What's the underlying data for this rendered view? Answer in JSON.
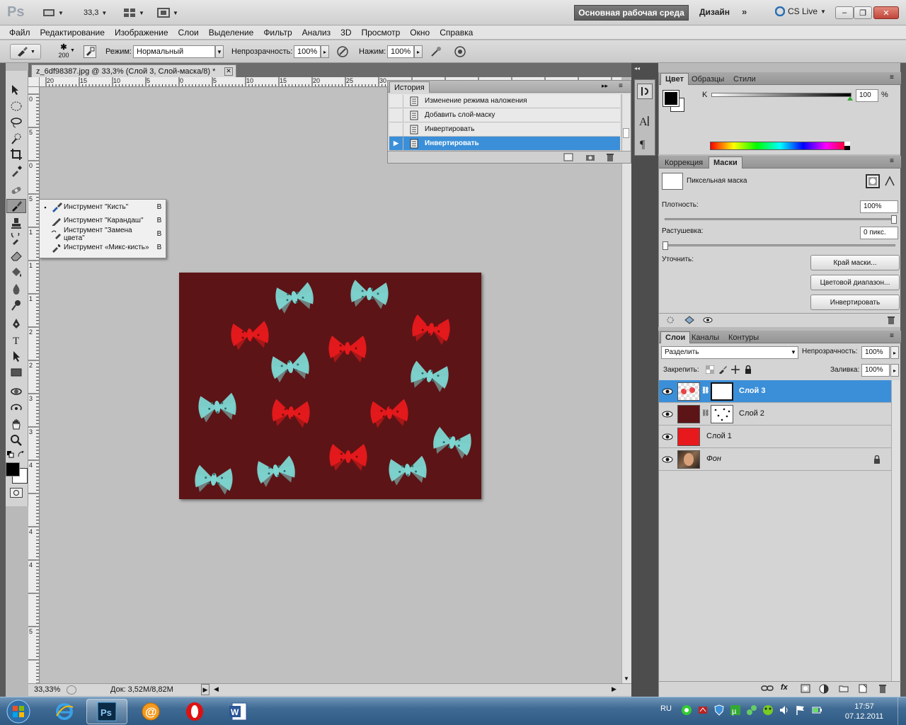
{
  "appbar": {
    "logo": "Ps",
    "zoom": "33,3",
    "workspace_active": "Основная рабочая среда",
    "workspace_design": "Дизайн",
    "more": "»",
    "cslive": "CS Live",
    "window_buttons": [
      "–",
      "❐",
      "✕"
    ]
  },
  "menu": [
    "Файл",
    "Редактирование",
    "Изображение",
    "Слои",
    "Выделение",
    "Фильтр",
    "Анализ",
    "3D",
    "Просмотр",
    "Окно",
    "Справка"
  ],
  "options": {
    "brush_size": "200",
    "mode_label": "Режим:",
    "mode_value": "Нормальный",
    "opacity_label": "Непрозрачность:",
    "opacity_value": "100%",
    "pressure_label": "Нажим:",
    "pressure_value": "100%"
  },
  "document": {
    "tab_title": "z_6df98387.jpg @ 33,3% (Слой 3, Слой-маска/8) *",
    "close": "✕",
    "ruler_top": [
      "20",
      "15",
      "10",
      "5",
      "0",
      "5",
      "10",
      "15",
      "20",
      "25",
      "30"
    ],
    "ruler_left": [
      "0",
      "5",
      "0",
      "5",
      "1",
      "1",
      "1",
      "2",
      "2",
      "3",
      "3",
      "4",
      "4",
      "4",
      "5"
    ],
    "status_zoom": "33,33%",
    "status_doc": "Док: 3,52M/8,82M",
    "background_color": "#5d1416"
  },
  "flyout": {
    "items": [
      {
        "label": "Инструмент \"Кисть\"",
        "key": "B",
        "selected": "▪"
      },
      {
        "label": "Инструмент \"Карандаш\"",
        "key": "B",
        "selected": ""
      },
      {
        "label": "Инструмент \"Замена цвета\"",
        "key": "B",
        "selected": ""
      },
      {
        "label": "Инструмент «Микс-кисть»",
        "key": "B",
        "selected": ""
      }
    ]
  },
  "history": {
    "tab": "История",
    "items": [
      {
        "label": "Изменение режима наложения"
      },
      {
        "label": "Добавить слой-маску"
      },
      {
        "label": "Инвертировать"
      },
      {
        "label": "Инвертировать"
      }
    ],
    "active_index": 3
  },
  "color_panel": {
    "tabs": [
      "Цвет",
      "Образцы",
      "Стили"
    ],
    "channel": "K",
    "value": "100",
    "unit": "%"
  },
  "masks_panel": {
    "tabs": [
      "Коррекция",
      "Маски"
    ],
    "mask_type": "Пиксельная маска",
    "density_label": "Плотность:",
    "density_value": "100%",
    "feather_label": "Растушевка:",
    "feather_value": "0 пикс.",
    "refine_label": "Уточнить:",
    "buttons": [
      "Край маски...",
      "Цветовой диапазон...",
      "Инвертировать"
    ]
  },
  "layers_panel": {
    "tabs": [
      "Слои",
      "Каналы",
      "Контуры"
    ],
    "blend_mode": "Разделить",
    "opacity_label": "Непрозрачность:",
    "opacity_value": "100%",
    "lock_label": "Закрепить:",
    "fill_label": "Заливка:",
    "fill_value": "100%",
    "layers": [
      {
        "name": "Слой 3"
      },
      {
        "name": "Слой 2"
      },
      {
        "name": "Слой 1"
      },
      {
        "name": "Фон"
      }
    ]
  },
  "taskbar": {
    "lang": "RU",
    "time": "17:57",
    "date": "07.12.2011"
  },
  "colors": {
    "selection": "#3b8fd8",
    "bow_red": "#e8191c",
    "bow_teal": "#7dd6d2",
    "layer1_fill": "#e8191c",
    "layer2_fill": "#5d1416"
  }
}
